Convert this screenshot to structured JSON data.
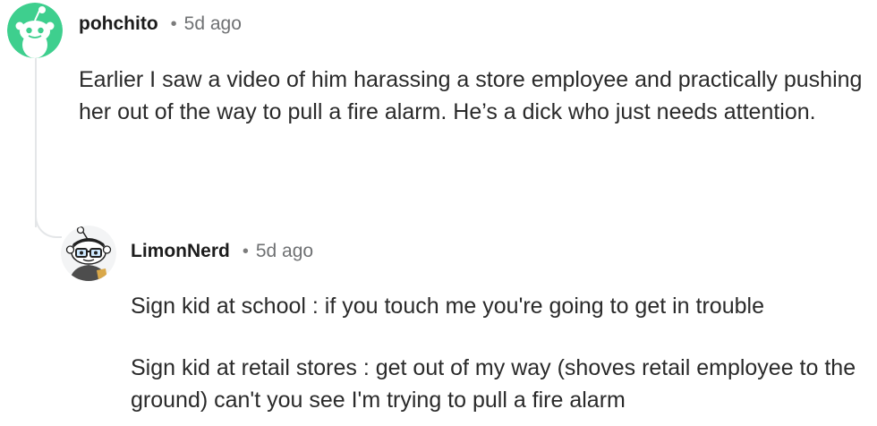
{
  "comments": [
    {
      "username": "pohchito",
      "separator": "•",
      "time": "5d ago",
      "avatar_icon": "snoo-green-avatar-icon",
      "body": "Earlier I saw a video of him harassing a store employee and practically pushing her out of the way to pull a fire alarm. He’s a dick who just needs attention."
    },
    {
      "username": "LimonNerd",
      "separator": "•",
      "time": "5d ago",
      "avatar_icon": "snoo-nerd-glasses-avatar-icon",
      "paragraphs": [
        "Sign kid at school : if you touch me you're going to get in trouble",
        "Sign kid at retail stores : get out of my way (shoves retail employee to the ground) can't you see I'm trying to pull a fire alarm"
      ]
    }
  ],
  "colors": {
    "avatar_green": "#3ecf8e",
    "thread_line": "#e4e6e8",
    "meta_gray": "#6f7173"
  }
}
